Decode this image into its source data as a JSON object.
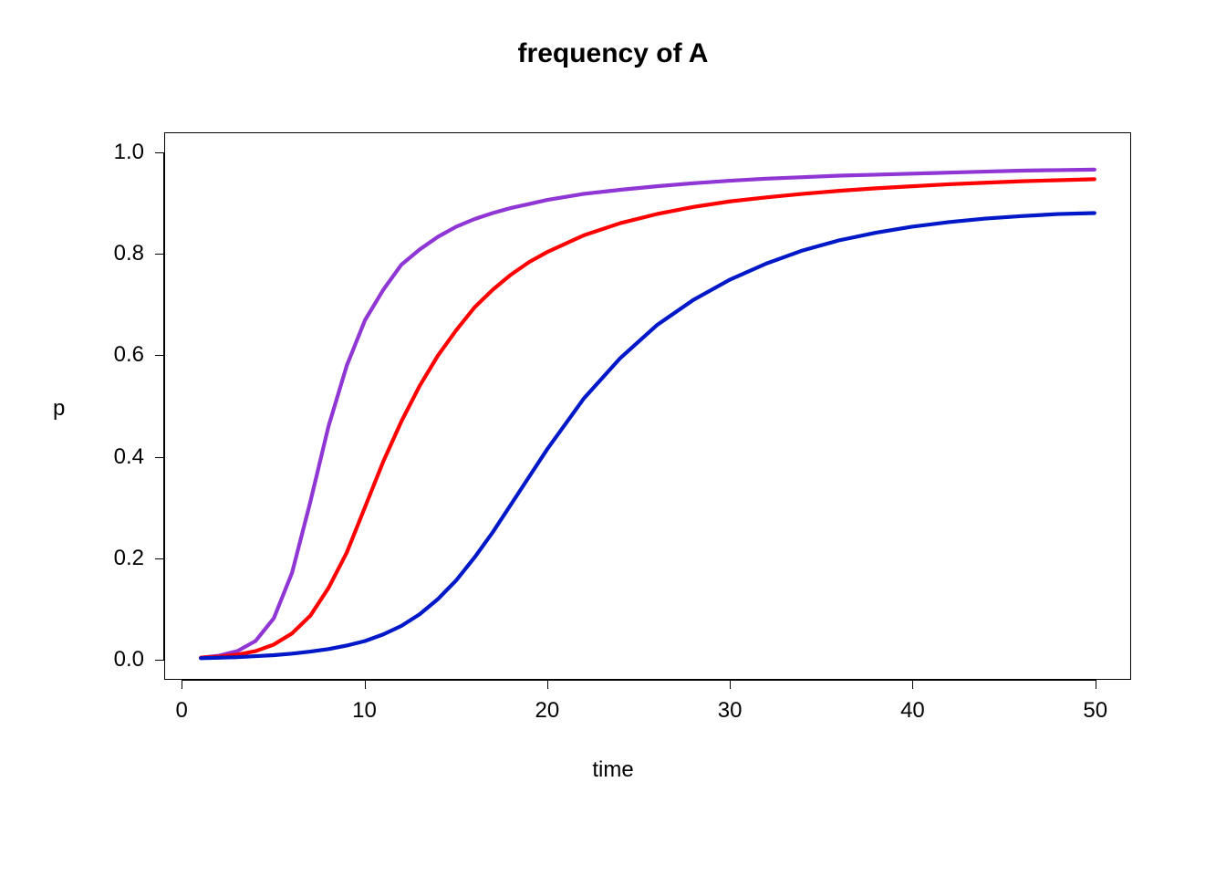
{
  "chart_data": {
    "type": "line",
    "title": "frequency of A",
    "xlabel": "time",
    "ylabel": "p",
    "xlim": [
      0,
      50
    ],
    "ylim": [
      0.0,
      1.0
    ],
    "x_ticks": [
      0,
      10,
      20,
      30,
      40,
      50
    ],
    "y_ticks": [
      0.0,
      0.2,
      0.4,
      0.6,
      0.8,
      1.0
    ],
    "y_tick_labels": [
      "0.0",
      "0.2",
      "0.4",
      "0.6",
      "0.8",
      "1.0"
    ],
    "data_xmin": 1,
    "data_xmax": 50,
    "series": [
      {
        "name": "series-purple",
        "color": "#8F36D4",
        "x": [
          1,
          2,
          3,
          4,
          5,
          6,
          7,
          8,
          9,
          10,
          11,
          12,
          13,
          14,
          15,
          16,
          17,
          18,
          19,
          20,
          22,
          24,
          26,
          28,
          30,
          32,
          34,
          36,
          38,
          40,
          42,
          44,
          46,
          48,
          50
        ],
        "y": [
          0.002,
          0.006,
          0.015,
          0.035,
          0.08,
          0.17,
          0.31,
          0.46,
          0.58,
          0.67,
          0.73,
          0.78,
          0.81,
          0.835,
          0.855,
          0.87,
          0.882,
          0.892,
          0.9,
          0.908,
          0.92,
          0.928,
          0.935,
          0.941,
          0.946,
          0.95,
          0.953,
          0.956,
          0.958,
          0.96,
          0.962,
          0.964,
          0.966,
          0.967,
          0.968
        ]
      },
      {
        "name": "series-red",
        "color": "#FF0000",
        "x": [
          1,
          2,
          3,
          4,
          5,
          6,
          7,
          8,
          9,
          10,
          11,
          12,
          13,
          14,
          15,
          16,
          17,
          18,
          19,
          20,
          22,
          24,
          26,
          28,
          30,
          32,
          34,
          36,
          38,
          40,
          42,
          44,
          46,
          48,
          50
        ],
        "y": [
          0.002,
          0.004,
          0.008,
          0.015,
          0.028,
          0.05,
          0.085,
          0.14,
          0.21,
          0.3,
          0.39,
          0.47,
          0.54,
          0.6,
          0.65,
          0.695,
          0.73,
          0.76,
          0.785,
          0.805,
          0.838,
          0.862,
          0.88,
          0.894,
          0.905,
          0.913,
          0.92,
          0.926,
          0.931,
          0.935,
          0.939,
          0.942,
          0.945,
          0.947,
          0.949
        ]
      },
      {
        "name": "series-blue",
        "color": "#0018C8",
        "x": [
          1,
          2,
          3,
          4,
          5,
          6,
          7,
          8,
          9,
          10,
          11,
          12,
          13,
          14,
          15,
          16,
          17,
          18,
          19,
          20,
          22,
          24,
          26,
          28,
          30,
          32,
          34,
          36,
          38,
          40,
          42,
          44,
          46,
          48,
          50
        ],
        "y": [
          0.001,
          0.002,
          0.003,
          0.005,
          0.007,
          0.01,
          0.014,
          0.019,
          0.026,
          0.035,
          0.048,
          0.065,
          0.088,
          0.118,
          0.155,
          0.2,
          0.25,
          0.305,
          0.36,
          0.415,
          0.515,
          0.595,
          0.66,
          0.71,
          0.75,
          0.782,
          0.808,
          0.828,
          0.843,
          0.855,
          0.864,
          0.871,
          0.876,
          0.88,
          0.882
        ]
      }
    ]
  }
}
